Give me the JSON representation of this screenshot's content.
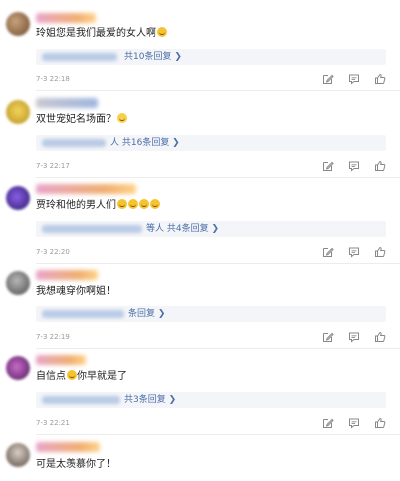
{
  "comments": [
    {
      "text": "玲姐您是我们最爱的女人啊",
      "reply_count": "共10条回复 ❯",
      "time": "7-3 22:18"
    },
    {
      "text": "双世宠妃名场面？",
      "reply_count": "人 共16条回复 ❯",
      "time": "7-3 22:17"
    },
    {
      "text": "贾玲和他的男人们",
      "reply_count": "等人 共4条回复 ❯",
      "time": "7-3 22:20"
    },
    {
      "text": "我想魂穿你啊姐！",
      "reply_count": "条回复 ❯",
      "time": "7-3 22:19"
    },
    {
      "text_before": "自信点",
      "text_after": "你早就是了",
      "reply_count": "共3条回复 ❯",
      "time": "7-3 22:21"
    },
    {
      "text": "可是太羡慕你了！"
    }
  ],
  "icons": [
    "edit-icon",
    "comment-icon",
    "like-icon"
  ],
  "colors": {
    "reply_link": "#4a6ea8",
    "reply_bg": "#f4f5f8",
    "time": "#9a9a9a",
    "emoji": "#f5c330"
  }
}
